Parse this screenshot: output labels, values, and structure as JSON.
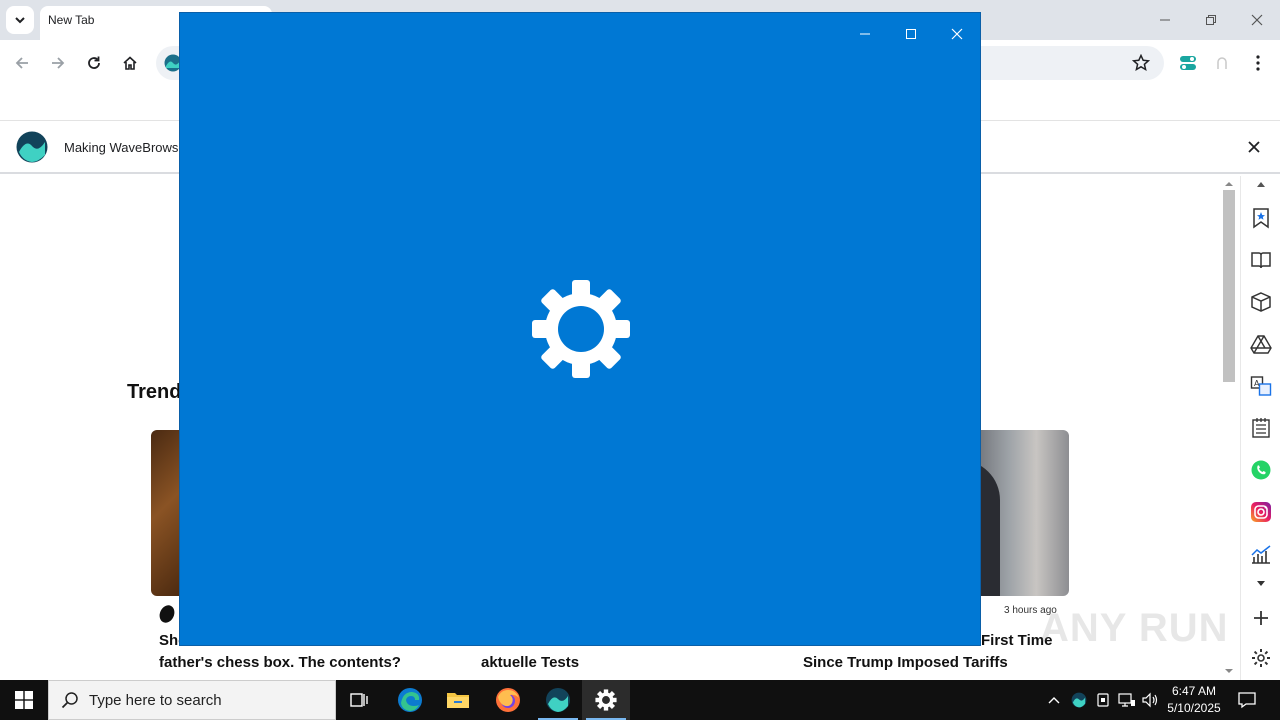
{
  "browser": {
    "tab_title": "New Tab",
    "infobar_text": "Making WaveBrowse",
    "icons": {
      "tab_search": "chevron-down-icon",
      "back": "back-arrow-icon",
      "forward": "forward-arrow-icon",
      "reload": "reload-icon",
      "home": "home-icon",
      "bookmark": "star-icon",
      "menu": "kebab-menu-icon"
    }
  },
  "page": {
    "trending_title": "Trend",
    "cards": [
      {
        "headline": "She … father's chess box. The contents?",
        "headline_line2": "father's chess box. The contents?"
      },
      {
        "headline_line2": "aktuelle Tests"
      },
      {
        "time": "3 hours ago",
        "headline_line1": "First Time",
        "headline_line2": "Since Trump Imposed Tariffs"
      }
    ]
  },
  "settings_window": {
    "background": "#0078d4",
    "icon": "gear-icon"
  },
  "taskbar": {
    "search_placeholder": "Type here to search",
    "time": "6:47 AM",
    "date": "5/10/2025"
  },
  "watermark": "ANY RUN",
  "colors": {
    "accent_blue": "#0078d4",
    "taskbar": "#101010",
    "tabstrip": "#dfe3e9"
  }
}
